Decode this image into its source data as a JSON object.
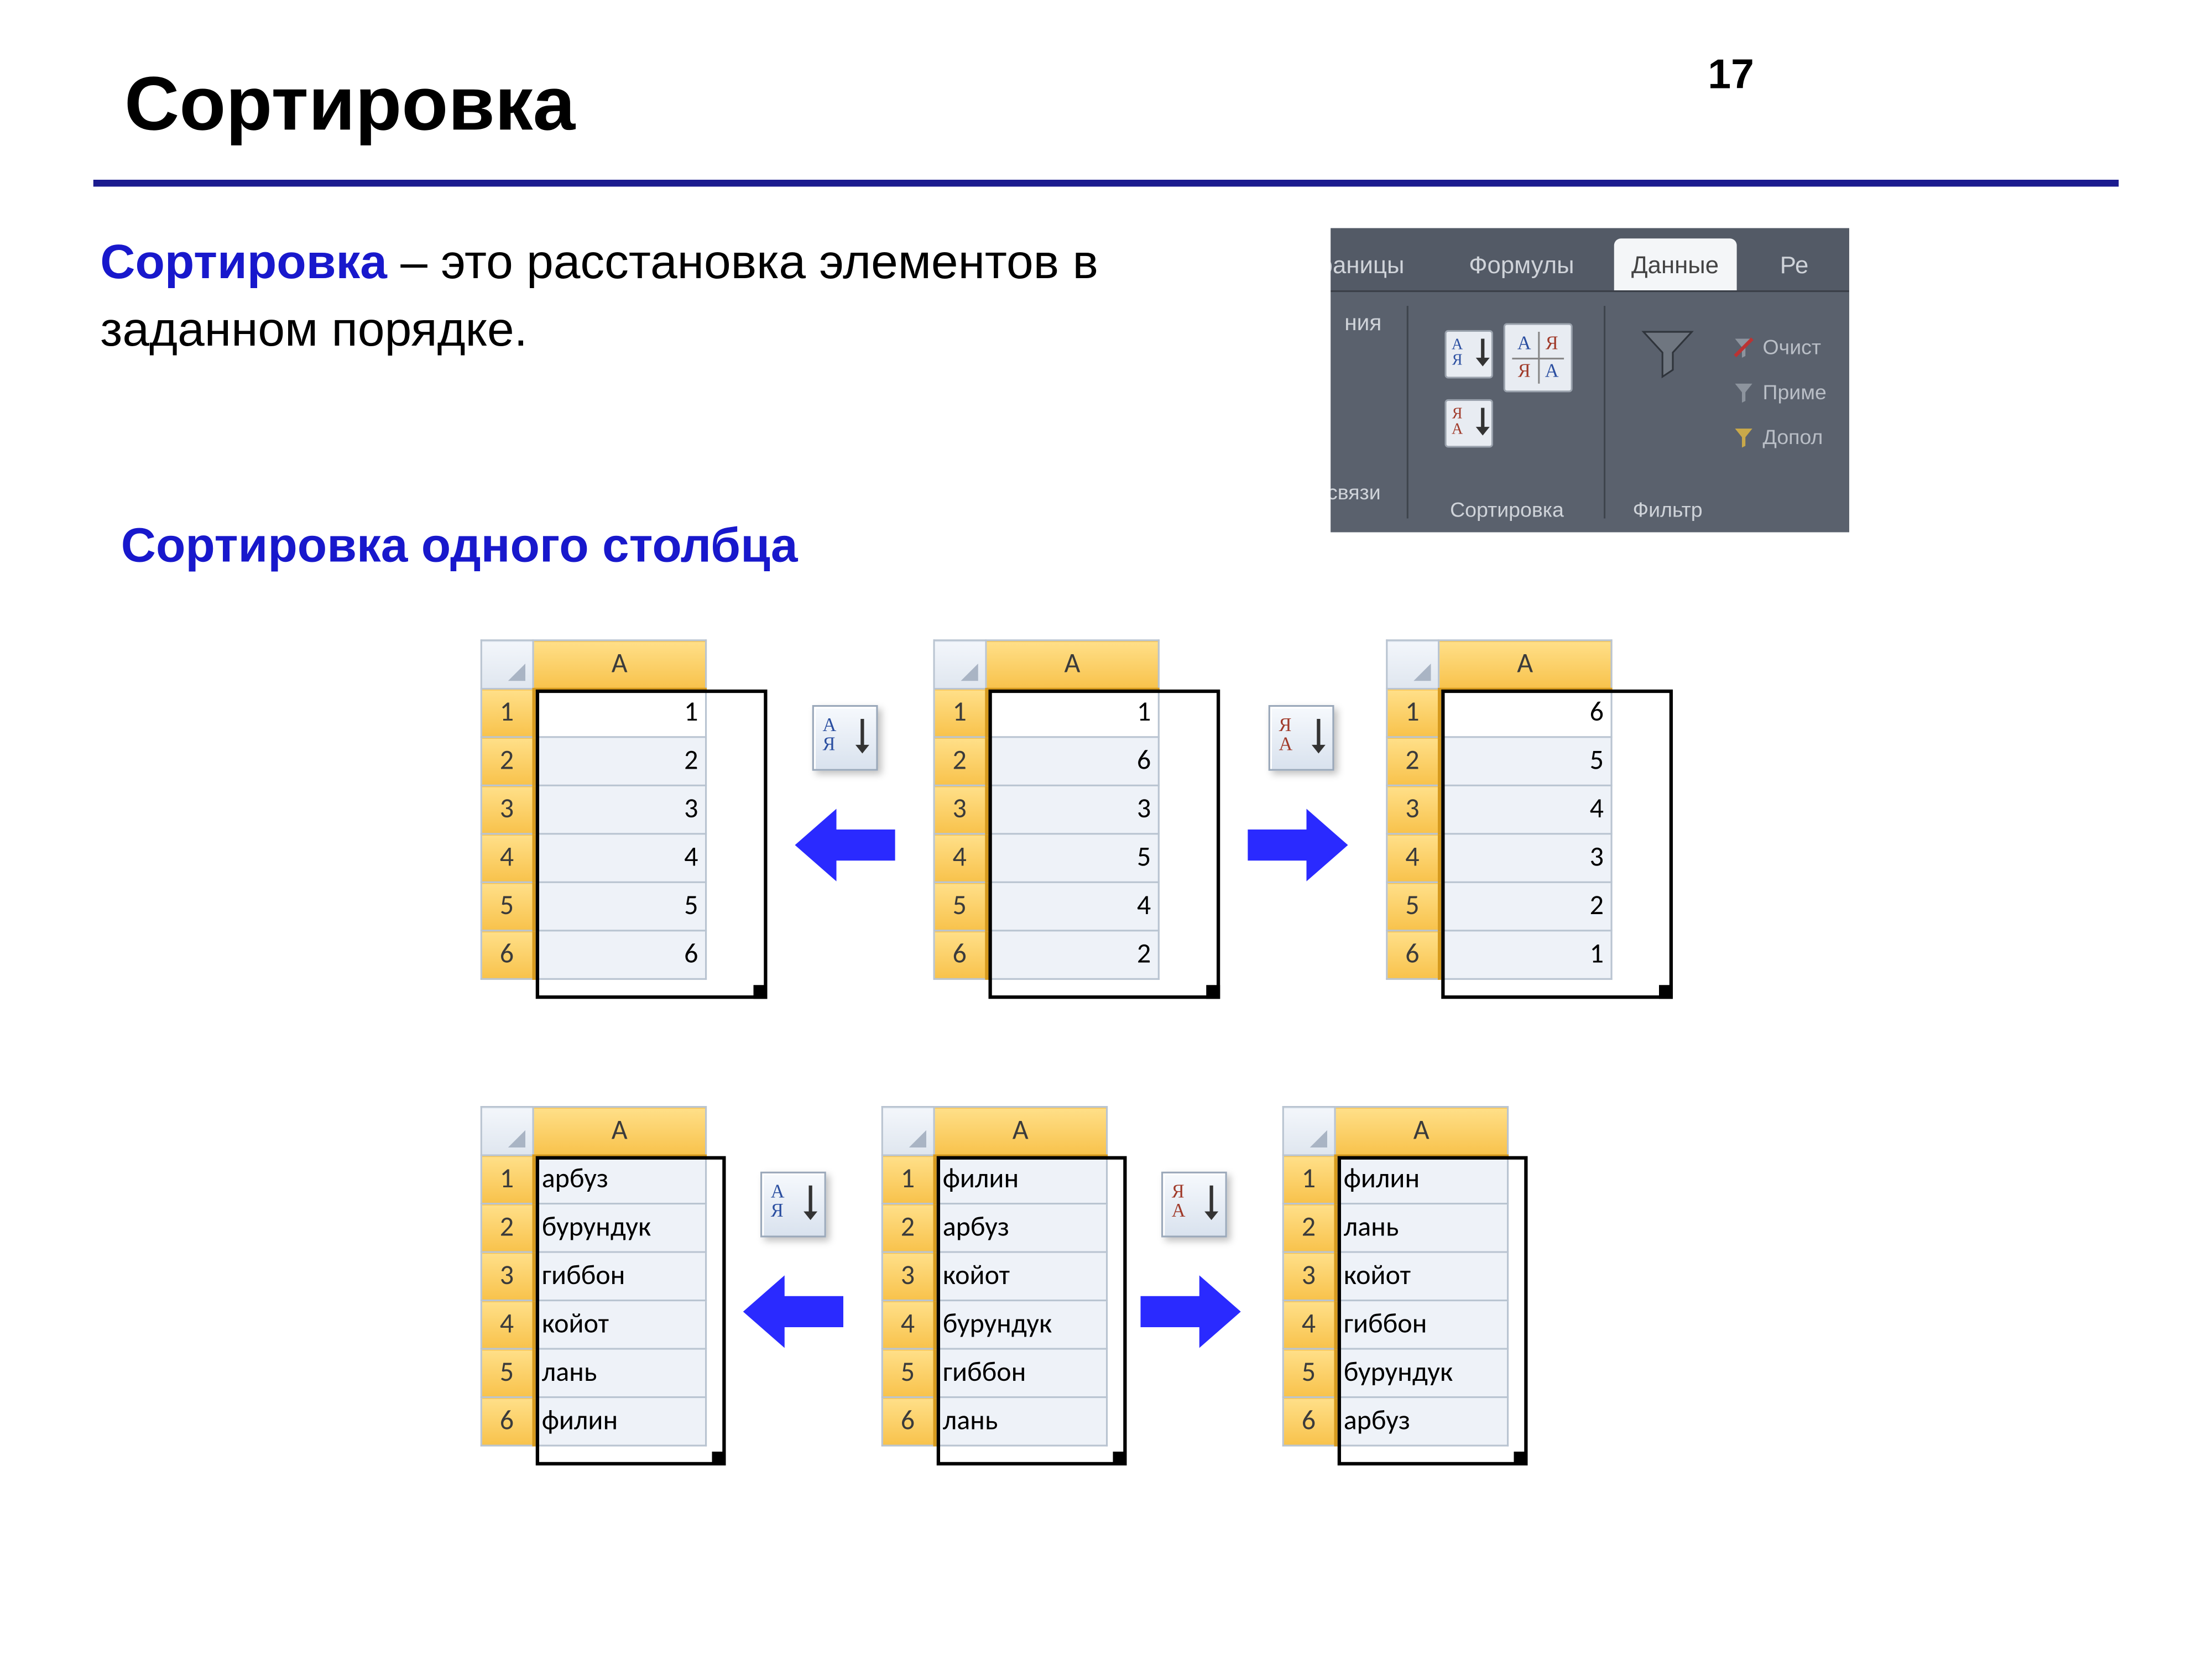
{
  "page_number": "17",
  "title": "Сортировка",
  "definition_term": "Сортировка",
  "definition_rest": " – это расстановка элементов в заданном порядке.",
  "subheading": "Сортировка одного столбца",
  "ribbon": {
    "tab_fragment_left": "страницы",
    "tab_formulas": "Формулы",
    "tab_data": "Данные",
    "tab_fragment_right": "Ре",
    "group_fragment_left": "ния",
    "group_fragment_left2": "связи",
    "sort_caption": "Сортировка",
    "filter_caption": "Фильтр",
    "extra_clear": "Очист",
    "extra_apply": "Приме",
    "extra_more": "Допол"
  },
  "col_header": "A",
  "row_headers": [
    "1",
    "2",
    "3",
    "4",
    "5",
    "6"
  ],
  "tables": {
    "num_asc": [
      "1",
      "2",
      "3",
      "4",
      "5",
      "6"
    ],
    "num_src": [
      "1",
      "6",
      "3",
      "5",
      "4",
      "2"
    ],
    "num_desc": [
      "6",
      "5",
      "4",
      "3",
      "2",
      "1"
    ],
    "txt_asc": [
      "арбуз",
      "бурундук",
      "гиббон",
      "койот",
      "лань",
      "филин"
    ],
    "txt_src": [
      "филин",
      "арбуз",
      "койот",
      "бурундук",
      "гиббон",
      "лань"
    ],
    "txt_desc": [
      "филин",
      "лань",
      "койот",
      "гиббон",
      "бурундук",
      "арбуз"
    ]
  }
}
